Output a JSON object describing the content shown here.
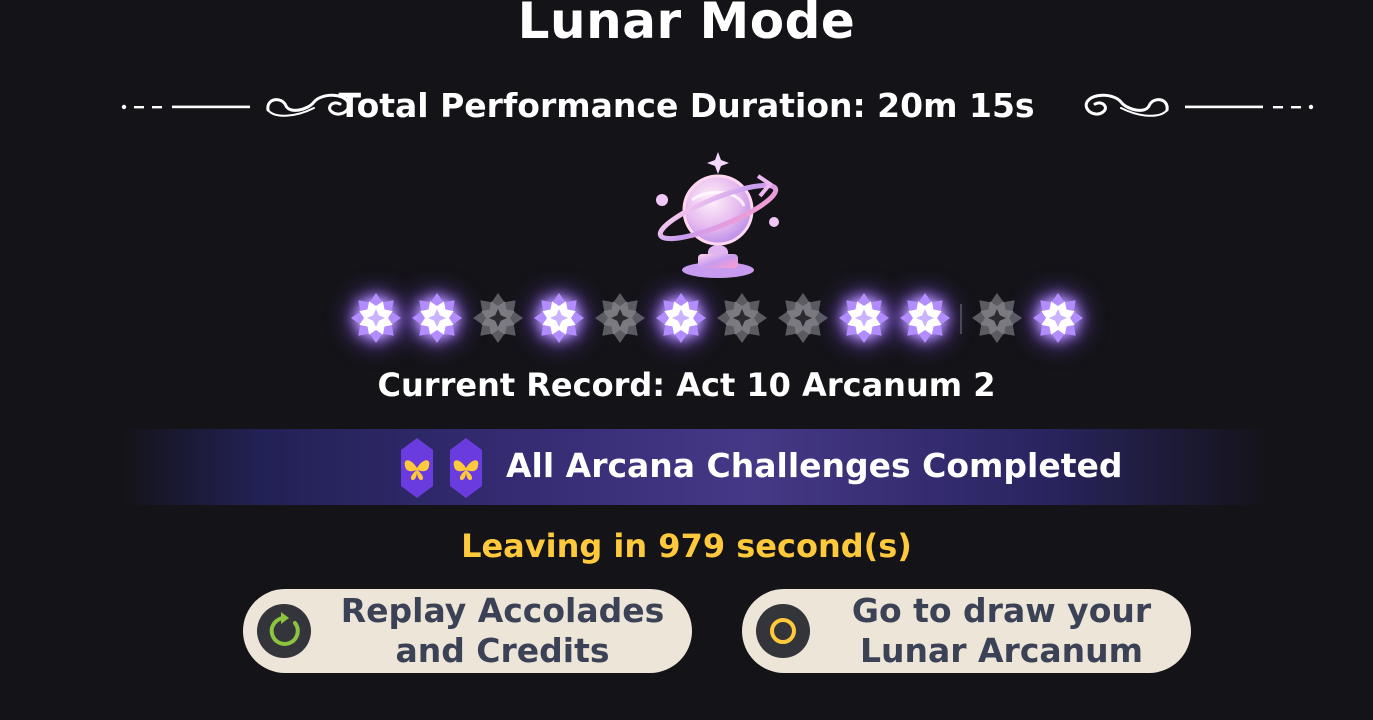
{
  "title": "Lunar Mode",
  "duration": {
    "label": "Total Performance Duration: 20m 15s"
  },
  "stars": {
    "first_group": [
      true,
      true,
      false,
      true,
      false,
      true,
      false,
      false,
      true,
      true
    ],
    "second_group": [
      false,
      true
    ]
  },
  "record": "Current Record: Act 10 Arcanum 2",
  "banner": {
    "text": "All Arcana Challenges Completed"
  },
  "leaving": "Leaving in 979 second(s)",
  "buttons": {
    "replay": {
      "line1": "Replay Accolades",
      "line2": "and Credits",
      "icon": "replay-icon"
    },
    "draw": {
      "line1": "Go to draw your",
      "line2": "Lunar Arcanum",
      "icon": "ring-icon"
    }
  },
  "colors": {
    "background": "#141318",
    "accent_gold": "#ffc93c",
    "button_bg": "#ece5d8",
    "button_text": "#3b4256",
    "replay_icon": "#8bc43f",
    "ring_icon": "#ffc93c",
    "star_lit": "#b38dff",
    "star_dim": "#5b5b62"
  }
}
